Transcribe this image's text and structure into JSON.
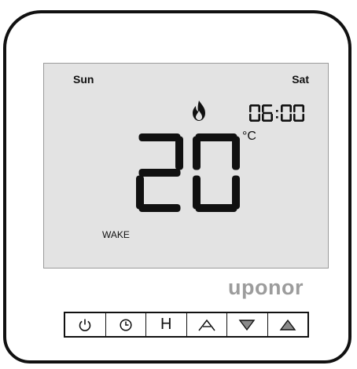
{
  "display": {
    "day_start": "Sun",
    "day_end": "Sat",
    "time_digits": [
      "0",
      "6",
      "0",
      "0"
    ],
    "temperature_digits": [
      "2",
      "0"
    ],
    "unit": "°C",
    "mode": "WAKE",
    "heating_icon": "flame-icon"
  },
  "brand": {
    "name": "uponor"
  },
  "buttons": [
    {
      "icon": "power-icon"
    },
    {
      "icon": "clock-icon"
    },
    {
      "label": "H"
    },
    {
      "icon": "chevron-up-icon"
    },
    {
      "icon": "triangle-down-icon"
    },
    {
      "icon": "triangle-up-icon"
    }
  ],
  "colors": {
    "lcd_background": "#e3e3e3",
    "segment": "#111111",
    "brand": "#9c9c9c"
  }
}
